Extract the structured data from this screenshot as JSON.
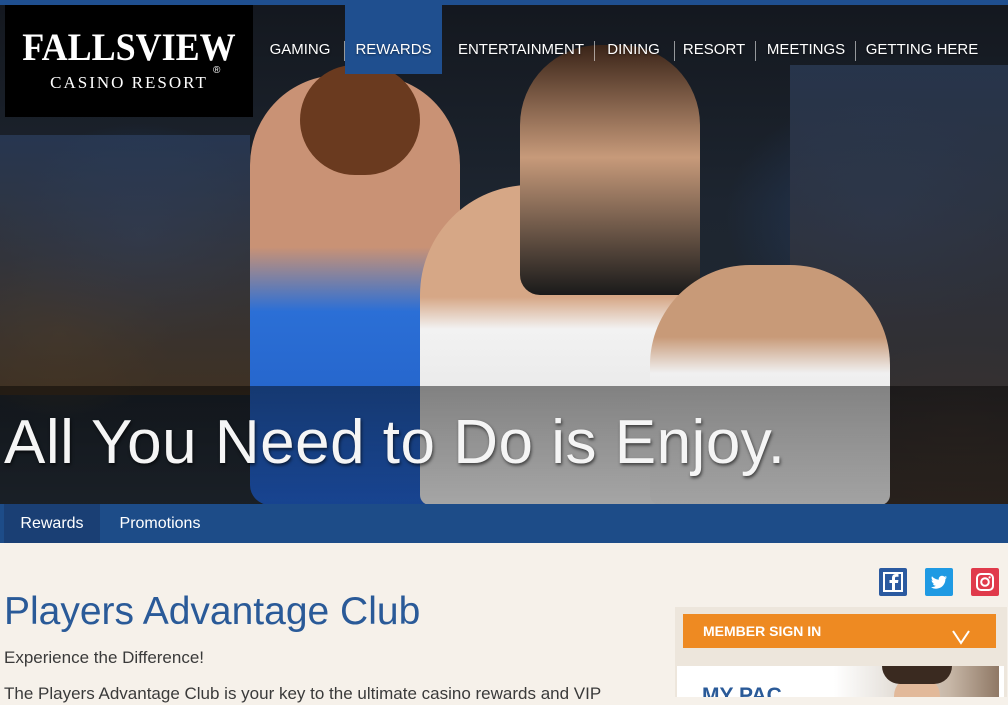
{
  "brand": {
    "logo_line1": "FALLSVIEW",
    "logo_line2": "CASINO RESORT",
    "logo_reg": "®"
  },
  "nav": {
    "items": [
      {
        "label": "GAMING"
      },
      {
        "label": "REWARDS",
        "active": true
      },
      {
        "label": "ENTERTAINMENT"
      },
      {
        "label": "DINING"
      },
      {
        "label": "RESORT"
      },
      {
        "label": "MEETINGS"
      },
      {
        "label": "GETTING HERE"
      }
    ]
  },
  "hero": {
    "headline": "All You Need to Do is Enjoy."
  },
  "subnav": {
    "items": [
      {
        "label": "Rewards",
        "active": true
      },
      {
        "label": "Promotions"
      }
    ]
  },
  "main": {
    "title": "Players Advantage Club",
    "intro": "Experience the Difference!",
    "body": "The Players Advantage Club is your key to the ultimate casino rewards and VIP"
  },
  "social": {
    "icons": [
      "facebook-icon",
      "twitter-icon",
      "instagram-icon"
    ],
    "colors": {
      "facebook": "#2b5aa0",
      "twitter": "#1f9ae3",
      "instagram": "#e03a4b"
    }
  },
  "sidebar": {
    "signin_label": "MEMBER SIGN IN",
    "mypac_title": "MY PAC"
  },
  "colors": {
    "brand_blue": "#1f4f8f",
    "accent_orange": "#ee8a22",
    "title_blue": "#2a5a98",
    "page_bg": "#f6f1ea"
  }
}
